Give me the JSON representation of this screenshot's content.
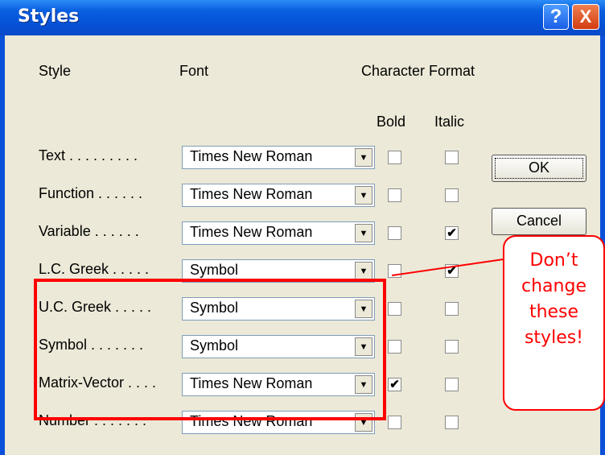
{
  "dialog": {
    "title": "Styles",
    "help_glyph": "?",
    "close_glyph": "X"
  },
  "headers": {
    "style": "Style",
    "font": "Font",
    "character_format": "Character Format",
    "bold": "Bold",
    "italic": "Italic"
  },
  "rows": [
    {
      "label": "Text . . . . . . . . .",
      "font": "Times New Roman",
      "bold": false,
      "italic": false
    },
    {
      "label": "Function . . . . . .",
      "font": "Times New Roman",
      "bold": false,
      "italic": false
    },
    {
      "label": "Variable . . . . . .",
      "font": "Times New Roman",
      "bold": false,
      "italic": true
    },
    {
      "label": "L.C. Greek . . . . .",
      "font": "Symbol",
      "bold": false,
      "italic": true
    },
    {
      "label": "U.C. Greek . . . . .",
      "font": "Symbol",
      "bold": false,
      "italic": false
    },
    {
      "label": "Symbol . . . . . . .",
      "font": "Symbol",
      "bold": false,
      "italic": false
    },
    {
      "label": "Matrix-Vector . . . .",
      "font": "Times New Roman",
      "bold": true,
      "italic": false
    },
    {
      "label": "Number . . . . . . .",
      "font": "Times New Roman",
      "bold": false,
      "italic": false
    }
  ],
  "buttons": {
    "ok": "OK",
    "cancel": "Cancel"
  },
  "callout": {
    "lines": [
      "Don’t",
      "change",
      "these",
      "styles!"
    ]
  },
  "check_glyph": "✔",
  "combo_arrow": "▼",
  "colors": {
    "annotation": "#ff0000",
    "titlebar": "#0551d6",
    "dialog_bg": "#ece9d8"
  }
}
